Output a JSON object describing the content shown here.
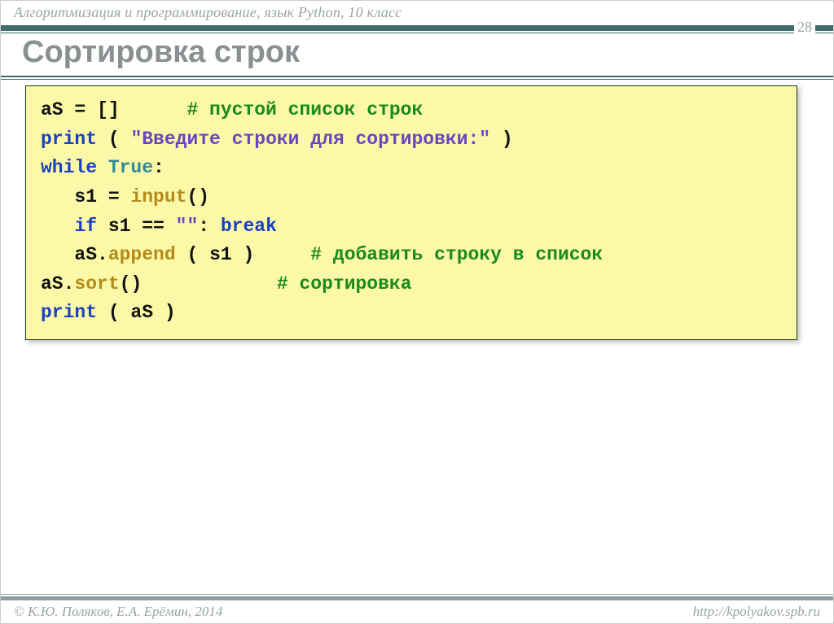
{
  "header": {
    "breadcrumb": "Алгоритмизация и программирование, язык Python, 10 класс",
    "page_number": "28"
  },
  "title": "Сортировка строк",
  "code": {
    "l1_a": "aS = []      ",
    "l1_c": "# пустой список строк",
    "l2_kw": "print",
    "l2_rest": " ( ",
    "l2_str": "\"Введите строки для сортировки:\"",
    "l2_end": " )",
    "l3_kw": "while",
    "l3_sp": " ",
    "l3_const": "True",
    "l3_colon": ":",
    "l4_a": "   s1 = ",
    "l4_func": "input",
    "l4_end": "()",
    "l5_a": "   ",
    "l5_kw1": "if",
    "l5_mid": " s1 == ",
    "l5_str": "\"\"",
    "l5_colon": ": ",
    "l5_kw2": "break",
    "l6_a": "   aS.",
    "l6_func": "append",
    "l6_mid": " ( s1 )     ",
    "l6_c": "# добавить строку в список",
    "l7_a": "aS.",
    "l7_func": "sort",
    "l7_mid": "()            ",
    "l7_c": "# сортировка",
    "l8_kw": "print",
    "l8_rest": " ( aS )"
  },
  "footer": {
    "left": "© К.Ю. Поляков, Е.А. Ерёмин, 2014",
    "right": "http://kpolyakov.spb.ru"
  }
}
